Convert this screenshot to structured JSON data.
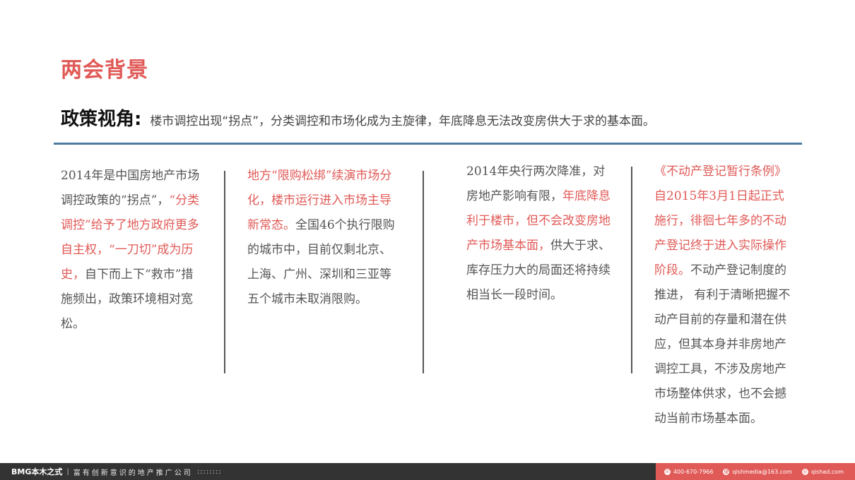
{
  "title": "两会背景",
  "policy": {
    "label": "政策视角",
    "colon": ":",
    "text": "楼市调控出现“拐点”，分类调控和市场化成为主旋律，年底降息无法改变房供大于求的基本面。"
  },
  "colors": {
    "accent": "#e05a57",
    "rule": "#4c7ca0",
    "footer": "#333333"
  },
  "columns": [
    {
      "segments": [
        {
          "text": "2014年是中国房地产市场调控政策的“拐点”，",
          "highlight": false
        },
        {
          "text": "“分类调控”给予了地方政府更多自主权，“一刀切”成为历史，",
          "highlight": true
        },
        {
          "text": "自下而上下“救市”措施频出，政策环境相对宽松。",
          "highlight": false
        }
      ]
    },
    {
      "segments": [
        {
          "text": "地方“限购松绑”续演市场分化，楼市运行进入市场主导新常态。",
          "highlight": true
        },
        {
          "text": "全国46个执行限购的城市中，目前仅剩北京、上海、广州、深圳和三亚等五个城市未取消限购。",
          "highlight": false
        }
      ]
    },
    {
      "segments": [
        {
          "text": "2014年央行两次降准，对房地产影响有限，",
          "highlight": false
        },
        {
          "text": "年底降息利于楼市，但不会改变房地产市场基本面，",
          "highlight": true
        },
        {
          "text": "供大于求、库存压力大的局面还将持续相当长一段时间。",
          "highlight": false
        }
      ]
    },
    {
      "segments": [
        {
          "text": "《不动产登记暂行条例》自2015年3月1日起正式施行，徘徊七年多的不动产登记终于进入实际操作阶段。",
          "highlight": true
        },
        {
          "text": "不动产登记制度的推进， 有利于清晰把握不动产目前的存量和潜在供应，但其本身并非房地产调控工具，不涉及房地产市场整体供求，也不会撼动当前市场基本面。",
          "highlight": false
        }
      ]
    }
  ],
  "footer": {
    "brand": "BMG本木之式",
    "separator": "|",
    "slogan": "富有创新意识的地产推广公司",
    "dots": "::::::::",
    "phone": "400-670-7966",
    "email": "qishmedia@163.com",
    "website": "qishad.com",
    "icons": [
      "phone-icon",
      "email-icon",
      "web-icon"
    ]
  }
}
